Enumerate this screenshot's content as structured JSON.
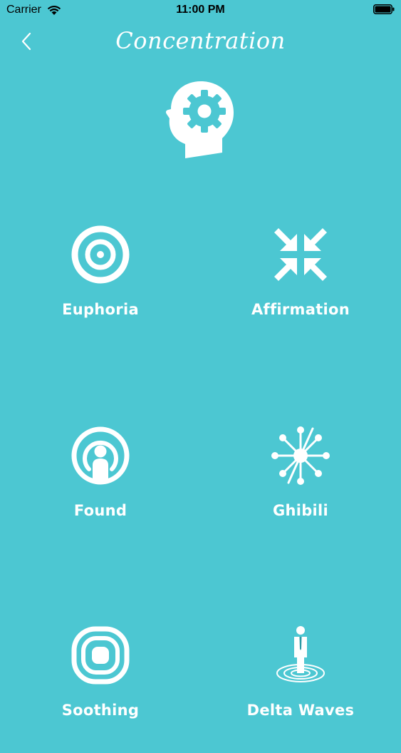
{
  "status_bar": {
    "carrier": "Carrier",
    "time": "11:00 PM"
  },
  "header": {
    "title": "Concentration"
  },
  "tiles": [
    {
      "label": "Euphoria",
      "icon": "target-icon"
    },
    {
      "label": "Affirmation",
      "icon": "compress-arrows-icon"
    },
    {
      "label": "Found",
      "icon": "podcast-person-icon"
    },
    {
      "label": "Ghibili",
      "icon": "network-hub-icon"
    },
    {
      "label": "Soothing",
      "icon": "rounded-square-rings-icon"
    },
    {
      "label": "Delta Waves",
      "icon": "person-ripples-icon"
    }
  ],
  "colors": {
    "background": "#4cc7d2",
    "foreground": "#ffffff"
  }
}
